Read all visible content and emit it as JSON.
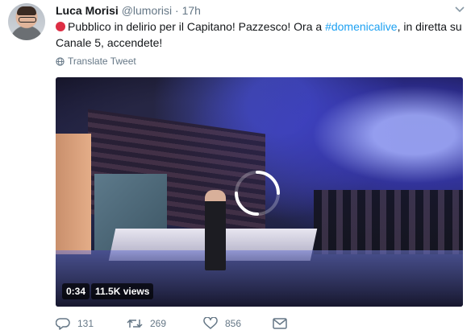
{
  "tweet": {
    "author_name": "Luca Morisi",
    "author_handle": "@lumorisi",
    "separator": "·",
    "time": "17h",
    "text_before": "Pubblico in delirio per il Capitano! Pazzesco! Ora a ",
    "hashtag": "#domenicalive",
    "text_after": ", in diretta su Canale 5, accendete!",
    "emoji": "red-circle",
    "translate_label": "Translate Tweet"
  },
  "video": {
    "duration": "0:34",
    "views": "11.5K views"
  },
  "actions": {
    "reply_count": "131",
    "retweet_count": "269",
    "like_count": "856"
  },
  "colors": {
    "link": "#1da1f2",
    "muted": "#657786",
    "emoji_red": "#dd2e44"
  },
  "icons": [
    "chevron-down-icon",
    "globe-icon",
    "loading-spinner-icon",
    "reply-icon",
    "retweet-icon",
    "heart-icon",
    "mail-icon"
  ]
}
